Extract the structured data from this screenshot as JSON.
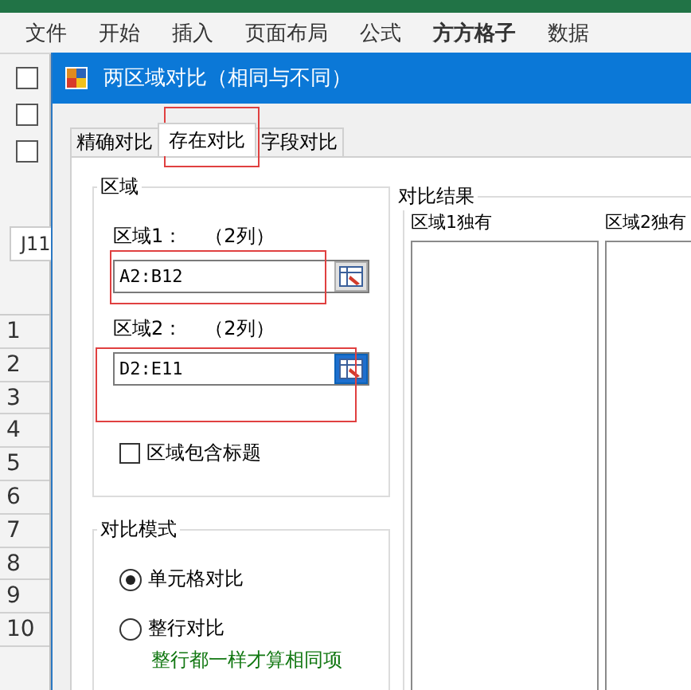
{
  "ribbon_tabs": [
    {
      "label": "文件",
      "emphasized": false
    },
    {
      "label": "开始",
      "emphasized": false
    },
    {
      "label": "插入",
      "emphasized": false
    },
    {
      "label": "页面布局",
      "emphasized": false
    },
    {
      "label": "公式",
      "emphasized": false
    },
    {
      "label": "方方格子",
      "emphasized": true
    },
    {
      "label": "数据",
      "emphasized": false
    }
  ],
  "sheet": {
    "checkboxes": [
      {
        "checked": false
      },
      {
        "checked": false
      },
      {
        "checked": false
      }
    ],
    "name_box": "J11",
    "row_numbers": [
      "1",
      "2",
      "3",
      "4",
      "5",
      "6",
      "7",
      "8",
      "9",
      "10"
    ]
  },
  "dialog": {
    "title": "两区域对比（相同与不同）",
    "tabs": [
      {
        "label": "精确对比",
        "selected": false
      },
      {
        "label": "存在对比",
        "selected": true
      },
      {
        "label": "字段对比",
        "selected": false
      }
    ],
    "range_group": {
      "title": "区域",
      "fields": [
        {
          "label": "区域1：",
          "note": "（2列）",
          "value": "A2:B12",
          "picker_active": false
        },
        {
          "label": "区域2：",
          "note": "（2列）",
          "value": "D2:E11",
          "picker_active": true
        }
      ],
      "header_checkbox": {
        "label": "区域包含标题",
        "checked": false
      }
    },
    "mode_group": {
      "title": "对比模式",
      "options": [
        {
          "label": "单元格对比",
          "selected": true
        },
        {
          "label": "整行对比",
          "selected": false
        }
      ],
      "hint": "整行都一样才算相同项"
    },
    "result_group": {
      "title": "对比结果",
      "lists": [
        {
          "label": "区域1独有"
        },
        {
          "label": "区域2独有"
        }
      ]
    }
  }
}
